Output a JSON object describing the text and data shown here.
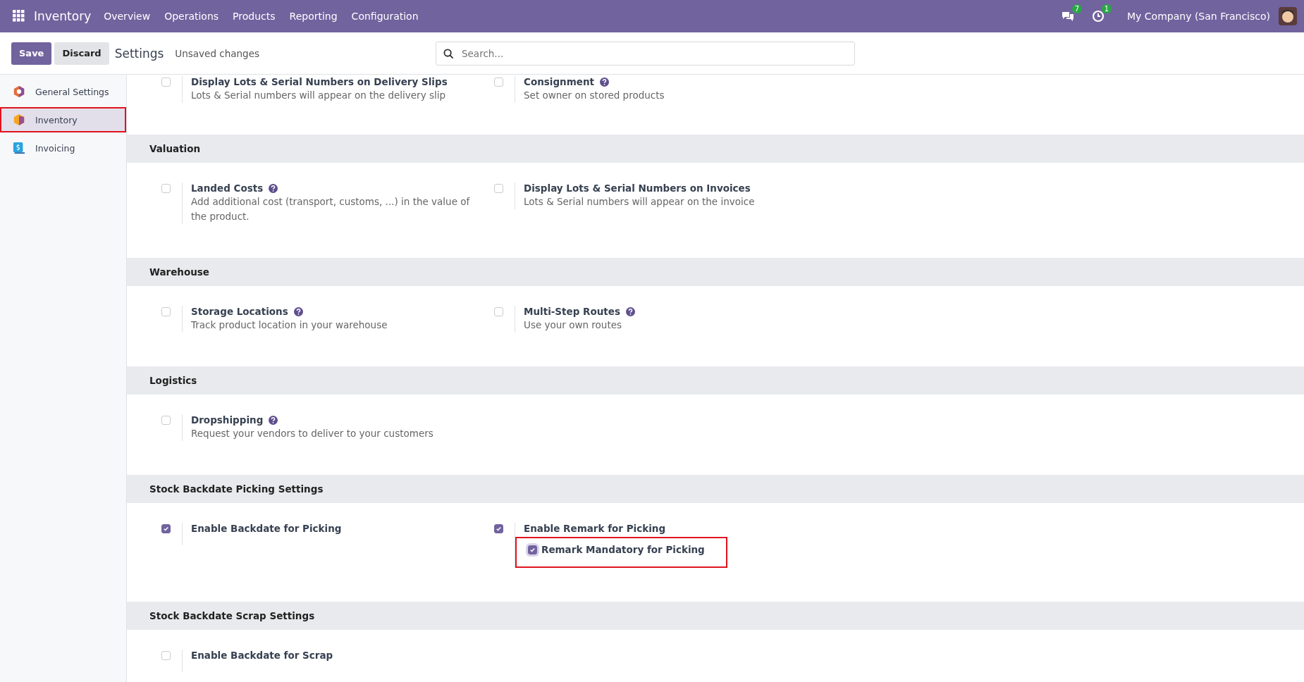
{
  "navbar": {
    "app_name": "Inventory",
    "menu": [
      "Overview",
      "Operations",
      "Products",
      "Reporting",
      "Configuration"
    ],
    "messages_count": "7",
    "activities_count": "1",
    "company": "My Company (San Francisco)"
  },
  "control_panel": {
    "save": "Save",
    "discard": "Discard",
    "title": "Settings",
    "status": "Unsaved changes",
    "search": {
      "placeholder": "Search..."
    }
  },
  "sidebar": {
    "items": [
      {
        "label": "General Settings",
        "kind": "general",
        "selected": false,
        "highlighted": false
      },
      {
        "label": "Inventory",
        "kind": "inventory",
        "selected": true,
        "highlighted": true
      },
      {
        "label": "Invoicing",
        "kind": "invoicing",
        "selected": false,
        "highlighted": false
      }
    ]
  },
  "sections": [
    {
      "settings": [
        {
          "label": "Display Lots & Serial Numbers on Delivery Slips",
          "description": "Lots & Serial numbers will appear on the delivery slip",
          "help": false,
          "checked": false
        },
        {
          "label": "Consignment",
          "description": "Set owner on stored products",
          "help": true,
          "checked": false
        }
      ]
    },
    {
      "title": "Valuation",
      "settings": [
        {
          "label": "Landed Costs",
          "description": "Add additional cost (transport, customs, ...) in the value of the product.",
          "help": true,
          "checked": false
        },
        {
          "label": "Display Lots & Serial Numbers on Invoices",
          "description": "Lots & Serial numbers will appear on the invoice",
          "help": false,
          "checked": false
        }
      ]
    },
    {
      "title": "Warehouse",
      "settings": [
        {
          "label": "Storage Locations",
          "description": "Track product location in your warehouse",
          "help": true,
          "checked": false
        },
        {
          "label": "Multi-Step Routes",
          "description": "Use your own routes",
          "help": true,
          "checked": false
        }
      ]
    },
    {
      "title": "Logistics",
      "settings": [
        {
          "label": "Dropshipping",
          "description": "Request your vendors to deliver to your customers",
          "help": true,
          "checked": false
        }
      ]
    },
    {
      "title": "Stock Backdate Picking Settings",
      "settings": [
        {
          "label": "Enable Backdate for Picking",
          "help": false,
          "checked": true
        },
        {
          "label": "Enable Remark for Picking",
          "help": false,
          "checked": true,
          "options": [
            {
              "label": "Remark Mandatory for Picking",
              "checked": true,
              "highlighted": true
            }
          ]
        }
      ]
    },
    {
      "title": "Stock Backdate Scrap Settings",
      "settings": [
        {
          "label": "Enable Backdate for Scrap",
          "help": false,
          "checked": false
        }
      ]
    }
  ]
}
